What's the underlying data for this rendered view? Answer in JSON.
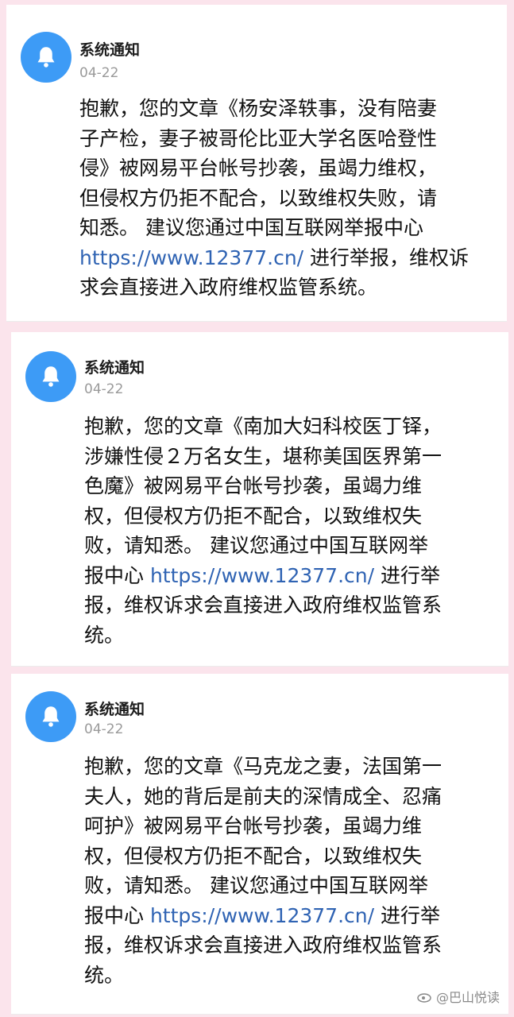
{
  "notices": [
    {
      "sender": "系统通知",
      "date": "04-22",
      "lines": [
        "抱歉，您的文章《杨安泽轶事，没有陪妻",
        "子产检，妻子被哥伦比亚大学名医哈登性",
        "侵》被网易平台帐号抄袭，虽竭力维权，",
        "但侵权方仍拒不配合，以致维权失败，请",
        "知悉。 建议您通过中国互联网举报中心"
      ],
      "link": "https://www.12377.cn/",
      "link_suffix": " 进行举报，维权诉",
      "tail": [
        "求会直接进入政府维权监管系统。"
      ]
    },
    {
      "sender": "系统通知",
      "date": "04-22",
      "lines": [
        "抱歉，您的文章《南加大妇科校医丁铎，",
        "涉嫌性侵２万名女生，堪称美国医界第一",
        "色魔》被网易平台帐号抄袭，虽竭力维",
        "权，但侵权方仍拒不配合，以致维权失",
        "败，请知悉。 建议您通过中国互联网举"
      ],
      "link_prefix": "报中心 ",
      "link": "https://www.12377.cn/",
      "link_suffix": " 进行举",
      "tail": [
        "报，维权诉求会直接进入政府维权监管系",
        "统。"
      ]
    },
    {
      "sender": "系统通知",
      "date": "04-22",
      "lines": [
        "抱歉，您的文章《马克龙之妻，法国第一",
        "夫人，她的背后是前夫的深情成全、忍痛",
        "呵护》被网易平台帐号抄袭，虽竭力维",
        "权，但侵权方仍拒不配合，以致维权失",
        "败，请知悉。 建议您通过中国互联网举"
      ],
      "link_prefix": "报中心 ",
      "link": "https://www.12377.cn/",
      "link_suffix": " 进行举",
      "tail": [
        "报，维权诉求会直接进入政府维权监管系",
        "统。"
      ]
    }
  ],
  "watermark": "@巴山悦读",
  "colors": {
    "avatar": "#3d9bf6",
    "link": "#2f63b3",
    "page_bg": "#fbe4ec"
  }
}
